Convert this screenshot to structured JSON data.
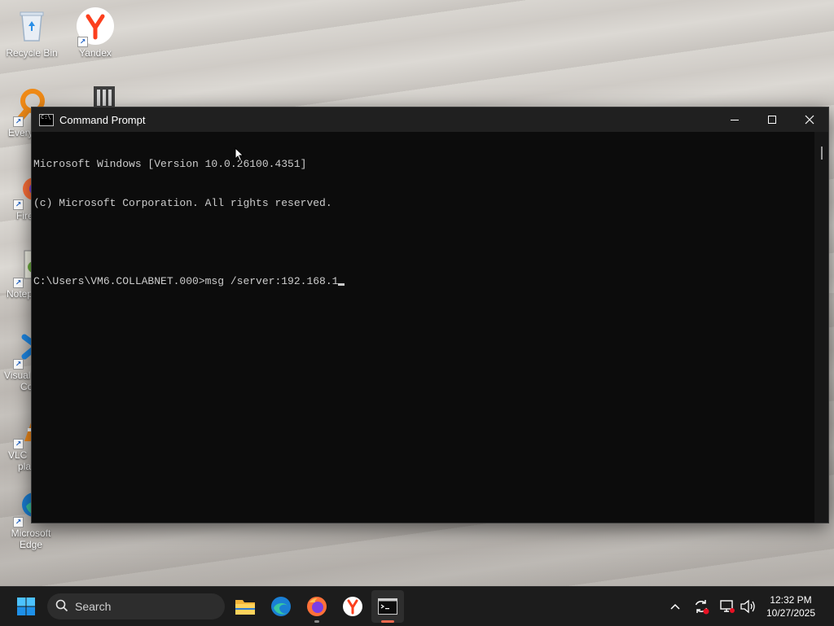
{
  "desktop": {
    "icons": [
      {
        "label": "Recycle Bin"
      },
      {
        "label": "Yandex"
      },
      {
        "label": "Every"
      },
      {
        "label": "Fire"
      },
      {
        "label": "Notep"
      },
      {
        "label": "Visual",
        "label2": "Co"
      },
      {
        "label": "VLC",
        "label2": "pla"
      },
      {
        "label": "Microsoft",
        "label2": "Edge"
      }
    ]
  },
  "window": {
    "title": "Command Prompt",
    "console_lines": [
      "Microsoft Windows [Version 10.0.26100.4351]",
      "(c) Microsoft Corporation. All rights reserved.",
      "",
      "C:\\Users\\VM6.COLLABNET.000>msg /server:192.168.1"
    ]
  },
  "taskbar": {
    "search_placeholder": "Search",
    "pinned": [
      {
        "icon": "file-explorer-icon"
      },
      {
        "icon": "edge-icon"
      },
      {
        "icon": "firefox-icon"
      },
      {
        "icon": "yandex-icon"
      },
      {
        "icon": "command-prompt-icon",
        "active": true
      }
    ],
    "tray": [
      "chevron-up-icon",
      "sync-icon",
      "network-icon",
      "volume-icon"
    ],
    "time": "12:32 PM",
    "date": "10/27/2025"
  },
  "colors": {
    "console_bg": "#0c0c0c",
    "console_text": "#cccccc",
    "titlebar_bg": "#202020",
    "taskbar_bg": "#1c1c1c",
    "accent": "#0078d4",
    "active_indicator": "#f0694f"
  }
}
